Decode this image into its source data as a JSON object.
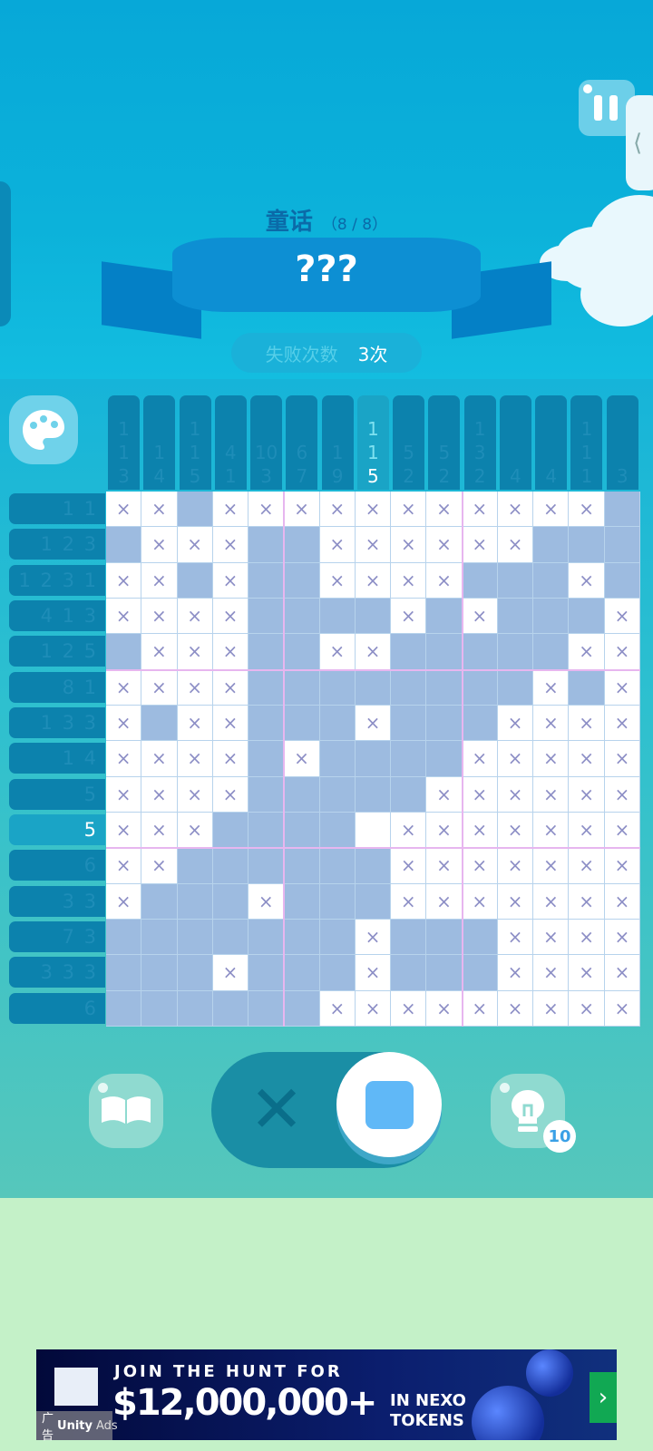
{
  "header": {
    "category": "童话",
    "progress": "（8 / 8）",
    "puzzle_name": "???",
    "fail_label": "失败次数",
    "fail_count": "3次"
  },
  "board": {
    "column_clues": [
      [
        "1",
        "1",
        "3"
      ],
      [
        "1",
        "4"
      ],
      [
        "1",
        "1",
        "5"
      ],
      [
        "4",
        "1"
      ],
      [
        "10",
        "3"
      ],
      [
        "6",
        "7"
      ],
      [
        "1",
        "9"
      ],
      [
        "1",
        "1",
        "5"
      ],
      [
        "5",
        "2"
      ],
      [
        "5",
        "2"
      ],
      [
        "1",
        "3",
        "2"
      ],
      [
        "4"
      ],
      [
        "4"
      ],
      [
        "1",
        "1",
        "1"
      ],
      [
        "3"
      ]
    ],
    "active_column": 7,
    "active_column_highlight_index": 2,
    "row_clues": [
      "1 1",
      "1 2 3",
      "1 2 3 1",
      "4 1 3",
      "1 2 5",
      "8 1",
      "1 3 3",
      "1 4",
      "5",
      "5",
      "6",
      "3 3",
      "7 3",
      "3 3 3",
      "6"
    ],
    "active_row": 9,
    "grid": [
      "XXFXXXXXXXXXXXF",
      "FXXXFFXXXXXXFFF",
      "XXFXFFXXXXFFFXF",
      "XXXXFFFFXFXFFFX",
      "FXXXFFXXFFFFFXX",
      "XXXXFFFFFFFFXFX",
      "XFXXFFFXFFFXXXX",
      "XXXXFXFFFFXXXXX",
      "XXXXFFFFFXXXXXX",
      "XXXFFFFWXXXXXXX",
      "XXFFFFFFXXXXXXX",
      "XFFFXFFFXXXXXXX",
      "FFFFFFFXFFFXXXX",
      "FFFXFFFXFFFXXXX",
      "FFFFFFXXXXXXXXX"
    ],
    "cross_glyph": "×"
  },
  "controls": {
    "cross_mode_glyph": "✕",
    "hint_count": "10",
    "side_tab_glyph": "⟨"
  },
  "ad": {
    "line1": "JOIN THE HUNT FOR",
    "line2": "$12,000,000+",
    "line3": "IN NEXO TOKENS",
    "arrow": "›",
    "label": "广告",
    "brand": "Unity",
    "brand_suffix": "Ads"
  },
  "colors": {
    "filled_cell": "#9dbbe0",
    "cross": "#8d8fc6",
    "clue_bg": "#0c82ad",
    "active_clue_bg": "#1aa4c6"
  }
}
